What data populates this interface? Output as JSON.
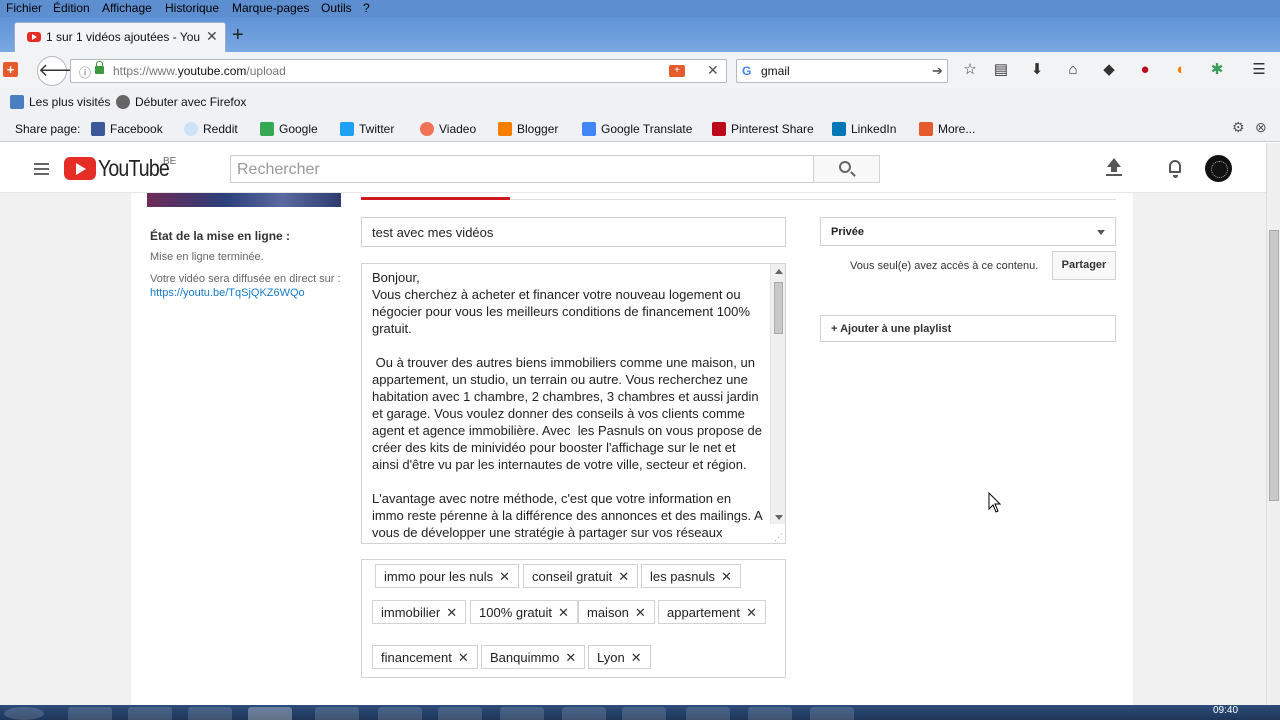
{
  "browser": {
    "menu": [
      "Fichier",
      "Édition",
      "Affichage",
      "Historique",
      "Marque-pages",
      "Outils",
      "?"
    ],
    "tab_title": "1 sur 1 vidéos ajoutées - You",
    "url_prefix": "https://www.",
    "url_domain": "youtube.com",
    "url_path": "/upload",
    "search_engine": "G",
    "search_query": "gmail",
    "bookmarks": [
      "Les plus visités",
      "Débuter avec Firefox"
    ],
    "share_label": "Share page:",
    "share_items": [
      {
        "label": "Facebook",
        "color": "#3b5998"
      },
      {
        "label": "Reddit",
        "color": "#cee3f8"
      },
      {
        "label": "Google",
        "color": "#34a853"
      },
      {
        "label": "Twitter",
        "color": "#1da1f2"
      },
      {
        "label": "Viadeo",
        "color": "#f07355"
      },
      {
        "label": "Blogger",
        "color": "#f57d00"
      },
      {
        "label": "Google Translate",
        "color": "#4285f4"
      },
      {
        "label": "Pinterest Share",
        "color": "#bd081c"
      },
      {
        "label": "LinkedIn",
        "color": "#0077b5"
      },
      {
        "label": "More...",
        "color": "#e55b2d"
      }
    ]
  },
  "youtube": {
    "logo_text": "YouTube",
    "country": "BE",
    "search_placeholder": "Rechercher"
  },
  "upload": {
    "status_title": "État de la mise en ligne :",
    "status_done": "Mise en ligne terminée.",
    "status_live": "Votre vidéo sera diffusée en direct sur : ",
    "video_link": "https://youtu.be/TqSjQKZ6WQo",
    "title_value": "test avec mes vidéos",
    "description": "Bonjour,\nVous cherchez à acheter et financer votre nouveau logement ou négocier pour vous les meilleurs conditions de financement 100% gratuit.\n\n Ou à trouver des autres biens immobiliers comme une maison, un appartement, un studio, un terrain ou autre. Vous recherchez une habitation avec 1 chambre, 2 chambres, 3 chambres et aussi jardin et garage. Vous voulez donner des conseils à vos clients comme agent et agence immobilière. Avec  les Pasnuls on vous propose de créer des kits de minividéo pour booster l'affichage sur le net et ainsi d'être vu par les internautes de votre ville, secteur et région.\n\nL'avantage avec notre méthode, c'est que votre information en immo reste pérenne à la différence des annonces et des mailings. A vous de développer une stratégie à partager sur vos réseaux",
    "tags": [
      "immo pour les nuls",
      "conseil gratuit",
      "les pasnuls",
      "immobilier",
      "100% gratuit",
      "maison",
      "appartement",
      "financement",
      "Banquimmo",
      "Lyon"
    ],
    "privacy": "Privée",
    "privacy_note": "Vous seul(e) avez accès à ce contenu.",
    "share_button": "Partager",
    "playlist_button": "+ Ajouter à une playlist"
  },
  "taskbar": {
    "clock": "09:40"
  }
}
